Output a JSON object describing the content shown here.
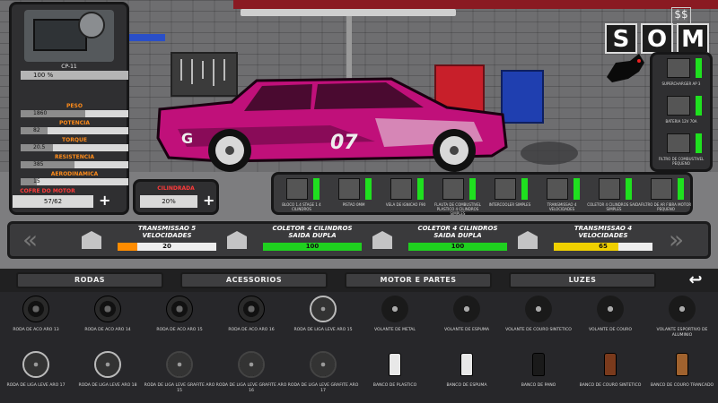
{
  "engine_panel": {
    "model": "CP-11",
    "condition": "100 %",
    "stats": [
      {
        "label": "PESO",
        "value": "1860",
        "level": 0.6
      },
      {
        "label": "POTENCIA",
        "value": "82",
        "level": 0.25
      },
      {
        "label": "TORQUE",
        "value": "20.5",
        "level": 0.3
      },
      {
        "label": "RESISTENCIA",
        "value": "385",
        "level": 0.5
      },
      {
        "label": "AERODINAMICA",
        "value": "15",
        "level": 0.15
      }
    ],
    "hood_label": "COFRE DO MOTOR",
    "hood_value": "57/62",
    "displacement_label": "CILINDRADA",
    "displacement_value": "20%",
    "plus": "+"
  },
  "car": {
    "plate_text": "07",
    "logo": "G"
  },
  "top_buttons": {
    "letters": [
      "S",
      "O",
      "M"
    ],
    "money_icon": "money-icon"
  },
  "right_parts": [
    {
      "label": "SUPERCHARGER AP 3"
    },
    {
      "label": "BATERIA 12V 70A"
    },
    {
      "label": "FILTRO DE COMBUSTIVEL PEQUENO"
    }
  ],
  "parts_strip": [
    {
      "label": "BLOCO 1.4 STAGE 1 4 CILINDROS"
    },
    {
      "label": "PISTAO 0MM"
    },
    {
      "label": "VELA DE IGNICAO F90"
    },
    {
      "label": "FLAUTA DE COMBUSTIVEL PLASTICO 4 CILINDROS SIMPLES"
    },
    {
      "label": "INTERCOOLER SIMPLES"
    },
    {
      "label": "TRANSMISSAO 4 VELOCIDADES"
    },
    {
      "label": "COLETOR 4 CILINDROS SAIDA SIMPLES"
    },
    {
      "label": "FILTRO DE AR FIBRA MOTOR PEQUENO"
    }
  ],
  "comparison": [
    {
      "name": "TRANSMISSAO 5\nVELOCIDADES",
      "value": "20",
      "fill": 0.2,
      "color": "#ff8c00"
    },
    {
      "name": "COLETOR 4 CILINDROS\nSAIDA DUPLA",
      "value": "100",
      "fill": 1.0,
      "color": "#1fd01f"
    },
    {
      "name": "COLETOR 4 CILINDROS\nSAIDA DUPLA",
      "value": "100",
      "fill": 1.0,
      "color": "#1fd01f"
    },
    {
      "name": "TRANSMISSAO 4\nVELOCIDADES",
      "value": "65",
      "fill": 0.65,
      "color": "#f0d000"
    }
  ],
  "nav": {
    "prev": "«",
    "next": "»"
  },
  "tabs": [
    {
      "label": "RODAS"
    },
    {
      "label": "ACESSORIOS"
    },
    {
      "label": "MOTOR E PARTES"
    },
    {
      "label": "LUZES"
    }
  ],
  "back_symbol": "↩",
  "items": [
    {
      "label": "RODA DE ACO ARO 13",
      "kind": "tire"
    },
    {
      "label": "RODA DE ACO ARO 14",
      "kind": "tire"
    },
    {
      "label": "RODA DE ACO ARO 15",
      "kind": "tire"
    },
    {
      "label": "RODA DE ACO ARO 16",
      "kind": "tire"
    },
    {
      "label": "RODA DE LIGA LEVE ARO 15",
      "kind": "rim"
    },
    {
      "label": "VOLANTE DE METAL",
      "kind": "wheel"
    },
    {
      "label": "VOLANTE DE ESPUMA",
      "kind": "wheel"
    },
    {
      "label": "VOLANTE DE COURO SINTETICO",
      "kind": "wheel"
    },
    {
      "label": "VOLANTE DE COURO",
      "kind": "wheel-brown"
    },
    {
      "label": "VOLANTE ESPORTIVO DE ALUMINIO",
      "kind": "wheel"
    },
    {
      "label": "RODA DE LIGA LEVE ARO 17",
      "kind": "rim"
    },
    {
      "label": "RODA DE LIGA LEVE ARO 18",
      "kind": "rim"
    },
    {
      "label": "RODA DE LIGA LEVE GRAFITE ARO 15",
      "kind": "rim-dark"
    },
    {
      "label": "RODA DE LIGA LEVE GRAFITE ARO 16",
      "kind": "rim-dark"
    },
    {
      "label": "RODA DE LIGA LEVE GRAFITE ARO 17",
      "kind": "rim-dark"
    },
    {
      "label": "BANCO DE PLASTICO",
      "kind": "seat-white"
    },
    {
      "label": "BANCO DE ESPUMA",
      "kind": "seat-white"
    },
    {
      "label": "BANCO DE PANO",
      "kind": "seat-black"
    },
    {
      "label": "BANCO DE COURO SINTETICO",
      "kind": "seat-brown"
    },
    {
      "label": "BANCO DE COURO TRANCADO",
      "kind": "seat-tan"
    }
  ],
  "colors": {
    "accent": "#ff8c1a",
    "green": "#1fe01f",
    "car": "#c0107a"
  }
}
